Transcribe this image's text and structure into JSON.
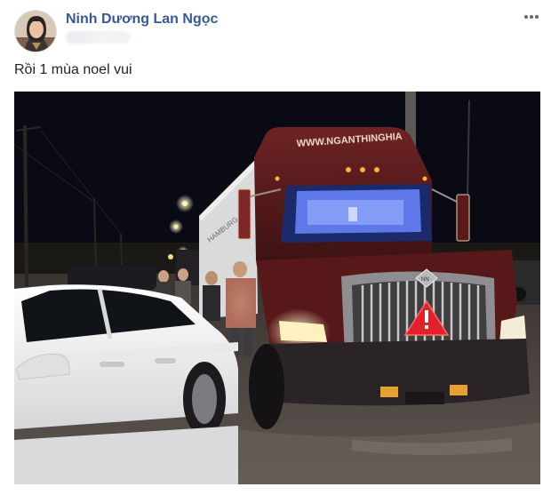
{
  "post": {
    "author_name": "Ninh Dương Lan Ngọc",
    "status_text": "Rồi 1 mùa noel vui",
    "more_options_icon": "more-horizontal-icon"
  },
  "photo": {
    "trailer_text": "WWW.NGANTHINGHIA",
    "grille_badge": "NN",
    "container_text": "HAMBURG SÜD"
  },
  "colors": {
    "author_link": "#365899",
    "text": "#1d2129",
    "truck_maroon": "#5a1a1c",
    "sky": "#0a0a14"
  }
}
